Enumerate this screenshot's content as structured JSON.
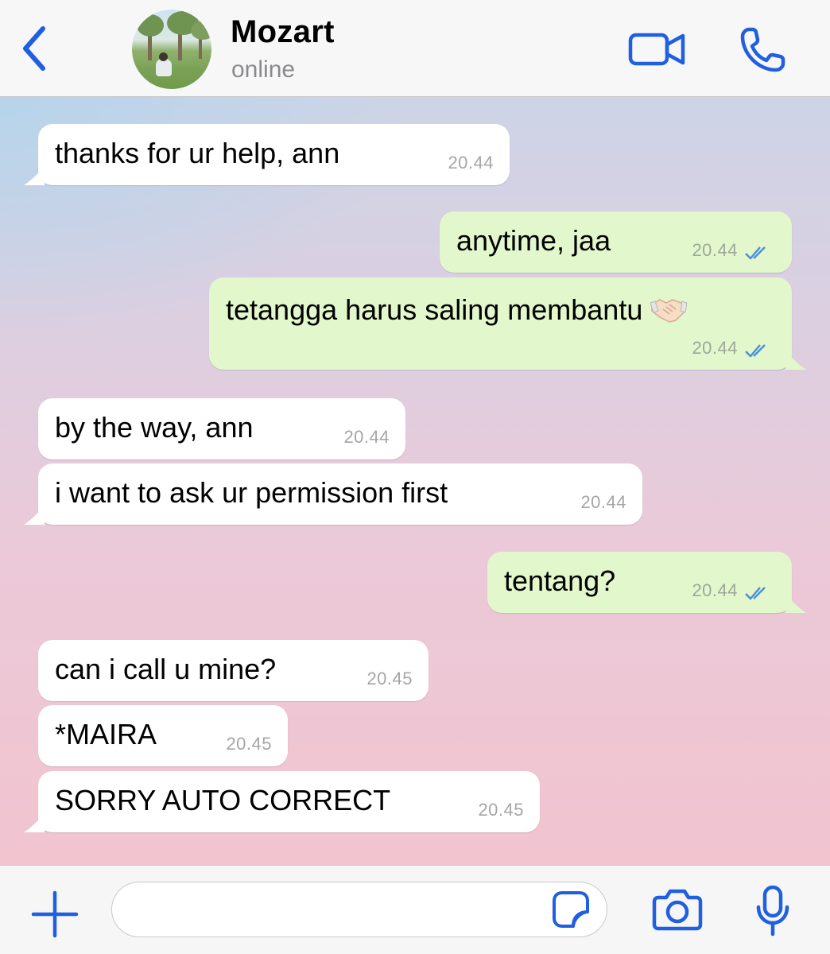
{
  "header": {
    "contact_name": "Mozart",
    "contact_status": "online"
  },
  "messages": [
    {
      "direction": "incoming",
      "text": "thanks for ur help, ann",
      "time": "20.44"
    },
    {
      "direction": "outgoing",
      "text": "anytime, jaa",
      "time": "20.44",
      "status": "read"
    },
    {
      "direction": "outgoing",
      "text": "tetangga harus saling membantu",
      "emoji": "handshake",
      "time": "20.44",
      "status": "read"
    },
    {
      "direction": "incoming",
      "text": "by the way, ann",
      "time": "20.44"
    },
    {
      "direction": "incoming",
      "text": "i want to ask ur permission first",
      "time": "20.44"
    },
    {
      "direction": "outgoing",
      "text": "tentang?",
      "time": "20.44",
      "status": "read"
    },
    {
      "direction": "incoming",
      "text": "can i call u mine?",
      "time": "20.45"
    },
    {
      "direction": "incoming",
      "text": "*MAIRA",
      "time": "20.45"
    },
    {
      "direction": "incoming",
      "text": "SORRY AUTO CORRECT",
      "time": "20.45"
    }
  ],
  "input": {
    "value": "",
    "placeholder": ""
  },
  "icons": {
    "back": "chevron-left-icon",
    "video": "video-camera-icon",
    "phone": "phone-icon",
    "attach": "plus-icon",
    "sticker": "sticker-icon",
    "camera": "camera-icon",
    "mic": "microphone-icon",
    "read_receipt": "double-check-icon"
  },
  "colors": {
    "accent": "#1f5fe0",
    "outgoing_bubble": "#e2f7cb",
    "incoming_bubble": "#ffffff",
    "read_tick": "#4a8fd9"
  }
}
